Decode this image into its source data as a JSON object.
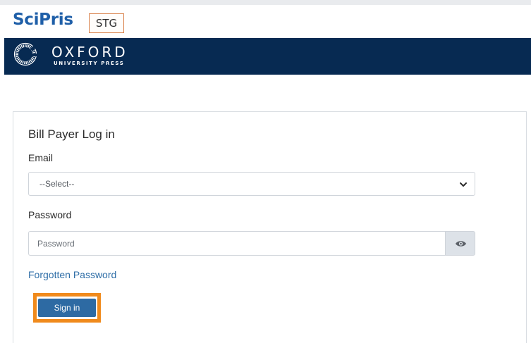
{
  "header": {
    "brand": "SciPris",
    "env_badge": "STG"
  },
  "banner": {
    "org_name": "OXFORD",
    "org_subtitle": "UNIVERSITY PRESS"
  },
  "login": {
    "title": "Bill Payer Log in",
    "email_label": "Email",
    "email_selected": "--Select--",
    "password_label": "Password",
    "password_placeholder": "Password",
    "forgot_link": "Forgotten Password",
    "signin_label": "Sign in"
  },
  "icons": {
    "logo": "oxford-logo-icon",
    "dropdown": "chevron-down-icon",
    "toggle_password": "eye-icon"
  },
  "colors": {
    "brand": "#1f5fa8",
    "banner": "#072a52",
    "link": "#2f6ea7",
    "button": "#2d6aa3",
    "highlight": "#f08a1c",
    "badge_border": "#d9814a"
  }
}
